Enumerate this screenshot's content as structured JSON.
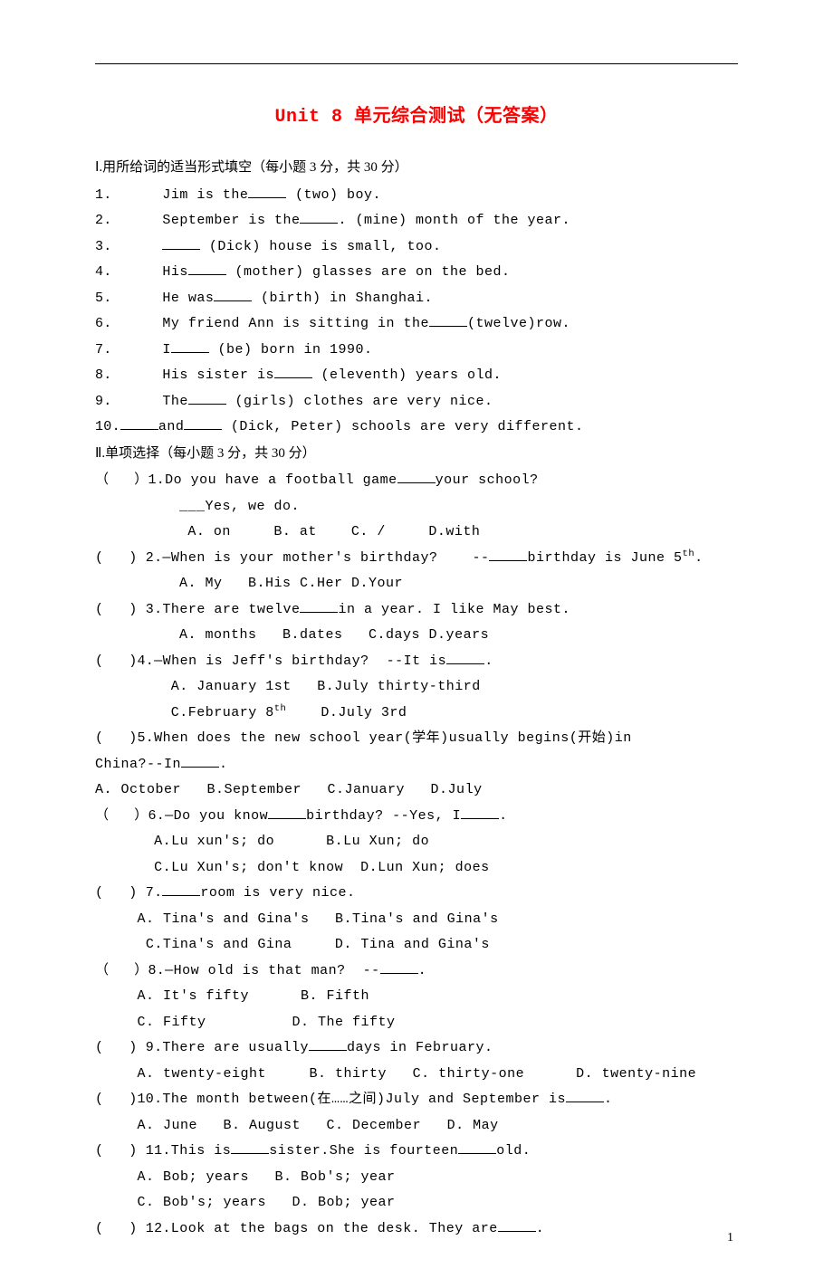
{
  "title": "Unit 8 单元综合测试（无答案）",
  "section1": {
    "heading": "Ⅰ.用所给词的适当形式填空（每小题 3 分，共 30 分）",
    "items": [
      {
        "n": "1.",
        "text_a": "Jim is the",
        "text_b": " (two) boy."
      },
      {
        "n": "2.",
        "text_a": "September is the",
        "text_b": ". (mine) month of the year."
      },
      {
        "n": "3.",
        "text_a": "",
        "text_b": " (Dick) house is small, too."
      },
      {
        "n": "4.",
        "text_a": "His",
        "text_b": " (mother) glasses are on the bed."
      },
      {
        "n": "5.",
        "text_a": "He was",
        "text_b": " (birth) in Shanghai."
      },
      {
        "n": "6.",
        "text_a": "My friend Ann is sitting in the",
        "text_b": "(twelve)row."
      },
      {
        "n": "7.",
        "text_a": "I",
        "text_b": " (be) born in 1990."
      },
      {
        "n": "8.",
        "text_a": "His sister is",
        "text_b": " (eleventh) years old."
      },
      {
        "n": "9.",
        "text_a": "The",
        "text_b": " (girls) clothes are very nice."
      }
    ],
    "item10": {
      "n": "10.",
      "a": "and",
      "b": " (Dick, Peter) schools are very different."
    }
  },
  "section2": {
    "heading": "Ⅱ.单项选择（每小题 3 分，共 30 分）",
    "q1": {
      "num": "（   ）1.",
      "stem_a": "Do you have a football game",
      "stem_b": "your school?",
      "line2": "___Yes, we do.",
      "opts": "A. on     B. at    C. /     D.with"
    },
    "q2": {
      "num": "(   ) 2.",
      "stem_a": "—When is your mother's birthday?    --",
      "stem_b": "birthday is June 5",
      "sup": "th",
      "tail": ".",
      "opts": "A. My   B.His C.Her D.Your"
    },
    "q3": {
      "num": "(   ) 3.",
      "stem_a": "There are twelve",
      "stem_b": "in a year. I like May best.",
      "opts": "A. months   B.dates   C.days D.years"
    },
    "q4": {
      "num": "(   )4.",
      "stem_a": "—When is Jeff's birthday?  --It is",
      "stem_b": ".",
      "opts1": "A. January 1st   B.July thirty-third",
      "opts2_a": "C.February 8",
      "opts2_sup": "th",
      "opts2_b": "    D.July 3rd"
    },
    "q5": {
      "num": "(   )5.",
      "stem_a": "When does the new school year(学年)usually begins(开始)in",
      "line2_a": "China?--In",
      "line2_b": ".",
      "opts": "A. October   B.September   C.January   D.July"
    },
    "q6": {
      "num": "（   ）6.",
      "stem_a": "—Do you know",
      "stem_mid": "birthday? --Yes, I",
      "stem_b": ".",
      "opts1": "A.Lu xun's; do      B.Lu Xun; do",
      "opts2": "C.Lu Xun's; don't know  D.Lun Xun; does"
    },
    "q7": {
      "num": "(   ) 7.",
      "stem_b": "room is very nice.",
      "opts1": "A. Tina's and Gina's   B.Tina's and Gina's",
      "opts2": "C.Tina's and Gina     D. Tina and Gina's"
    },
    "q8": {
      "num": "（   ）8.",
      "stem_a": "—How old is that man?  --",
      "stem_b": ".",
      "opts1": "A. It's fifty      B. Fifth",
      "opts2": "C. Fifty          D. The fifty"
    },
    "q9": {
      "num": "(   ) 9.",
      "stem_a": "There are usually",
      "stem_b": "days in February.",
      "opts": "A. twenty-eight     B. thirty   C. thirty-one      D. twenty-nine"
    },
    "q10": {
      "num": "(   )10.",
      "stem_a": "The month between(在……之间)July and September is",
      "stem_b": ".",
      "opts": "A. June   B. August   C. December   D. May"
    },
    "q11": {
      "num": "(   ) 11.",
      "stem_a": "This is",
      "stem_mid": "sister.She is fourteen",
      "stem_b": "old.",
      "opts1": "A. Bob; years   B. Bob's; year",
      "opts2": "C. Bob's; years   D. Bob; year"
    },
    "q12": {
      "num": "(   ) 12.",
      "stem_a": "Look at the bags on the desk. They are",
      "stem_b": "."
    }
  },
  "pagenum": "1"
}
